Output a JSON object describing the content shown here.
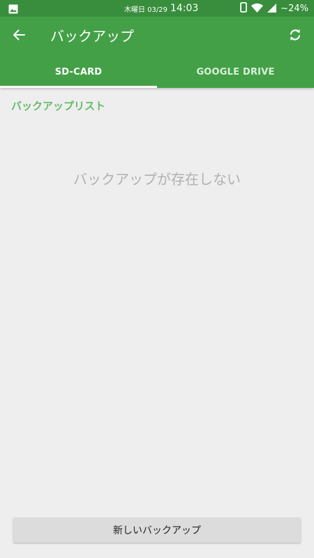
{
  "status_bar": {
    "day": "木曜日 03/29",
    "time": "14:03",
    "battery": "~24%",
    "icons": [
      "image-icon",
      "phone-icon",
      "wifi-icon",
      "signal-icon"
    ]
  },
  "app_bar": {
    "title": "バックアップ",
    "back_icon": "arrow-back-icon",
    "refresh_icon": "refresh-icon",
    "color": "#43a047"
  },
  "tabs": [
    {
      "label": "SD-CARD",
      "selected": true
    },
    {
      "label": "GOOGLE DRIVE",
      "selected": false
    }
  ],
  "main": {
    "section_label": "バックアップリスト",
    "empty_message": "バックアップが存在しない"
  },
  "footer": {
    "new_backup_label": "新しいバックアップ"
  },
  "colors": {
    "status_bar": "#388e3c",
    "app_bar": "#43a047",
    "accent": "#66bb6a",
    "background": "#eeeeee"
  }
}
